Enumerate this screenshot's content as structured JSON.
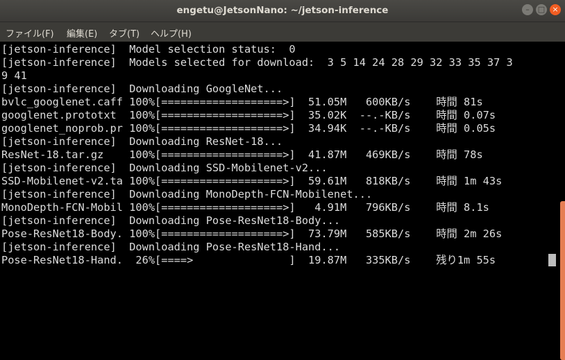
{
  "window": {
    "title": "engetu@JetsonNano: ~/jetson-inference",
    "controls": {
      "minimize": "–",
      "maximize": "□",
      "close": "×"
    }
  },
  "menu": [
    "ファイル(F)",
    "編集(E)",
    "タブ(T)",
    "ヘルプ(H)"
  ],
  "terminal": {
    "lines": [
      "[jetson-inference]  Model selection status:  0",
      "[jetson-inference]  Models selected for download:  3 5 14 24 28 29 32 33 35 37 3",
      "9 41",
      "[jetson-inference]  Downloading GoogleNet...",
      "bvlc_googlenet.caff 100%[===================>]  51.05M   600KB/s    時間 81s",
      "googlenet.prototxt  100%[===================>]  35.02K  --.-KB/s    時間 0.07s",
      "googlenet_noprob.pr 100%[===================>]  34.94K  --.-KB/s    時間 0.05s",
      "[jetson-inference]  Downloading ResNet-18...",
      "ResNet-18.tar.gz    100%[===================>]  41.87M   469KB/s    時間 78s",
      "[jetson-inference]  Downloading SSD-Mobilenet-v2...",
      "SSD-Mobilenet-v2.ta 100%[===================>]  59.61M   818KB/s    時間 1m 43s",
      "[jetson-inference]  Downloading MonoDepth-FCN-Mobilenet...",
      "MonoDepth-FCN-Mobil 100%[===================>]   4.91M   796KB/s    時間 8.1s",
      "[jetson-inference]  Downloading Pose-ResNet18-Body...",
      "Pose-ResNet18-Body. 100%[===================>]  73.79M   585KB/s    時間 2m 26s",
      "[jetson-inference]  Downloading Pose-ResNet18-Hand...",
      "Pose-ResNet18-Hand.  26%[====>               ]  19.87M   335KB/s    残り1m 55s"
    ],
    "scroll_position": 0.5
  },
  "colors": {
    "titlebar": "#3c3b37",
    "close_button": "#f15d22",
    "terminal_bg": "#000000",
    "terminal_fg": "#dcdcdc",
    "scroll_thumb": "#e67e54"
  }
}
